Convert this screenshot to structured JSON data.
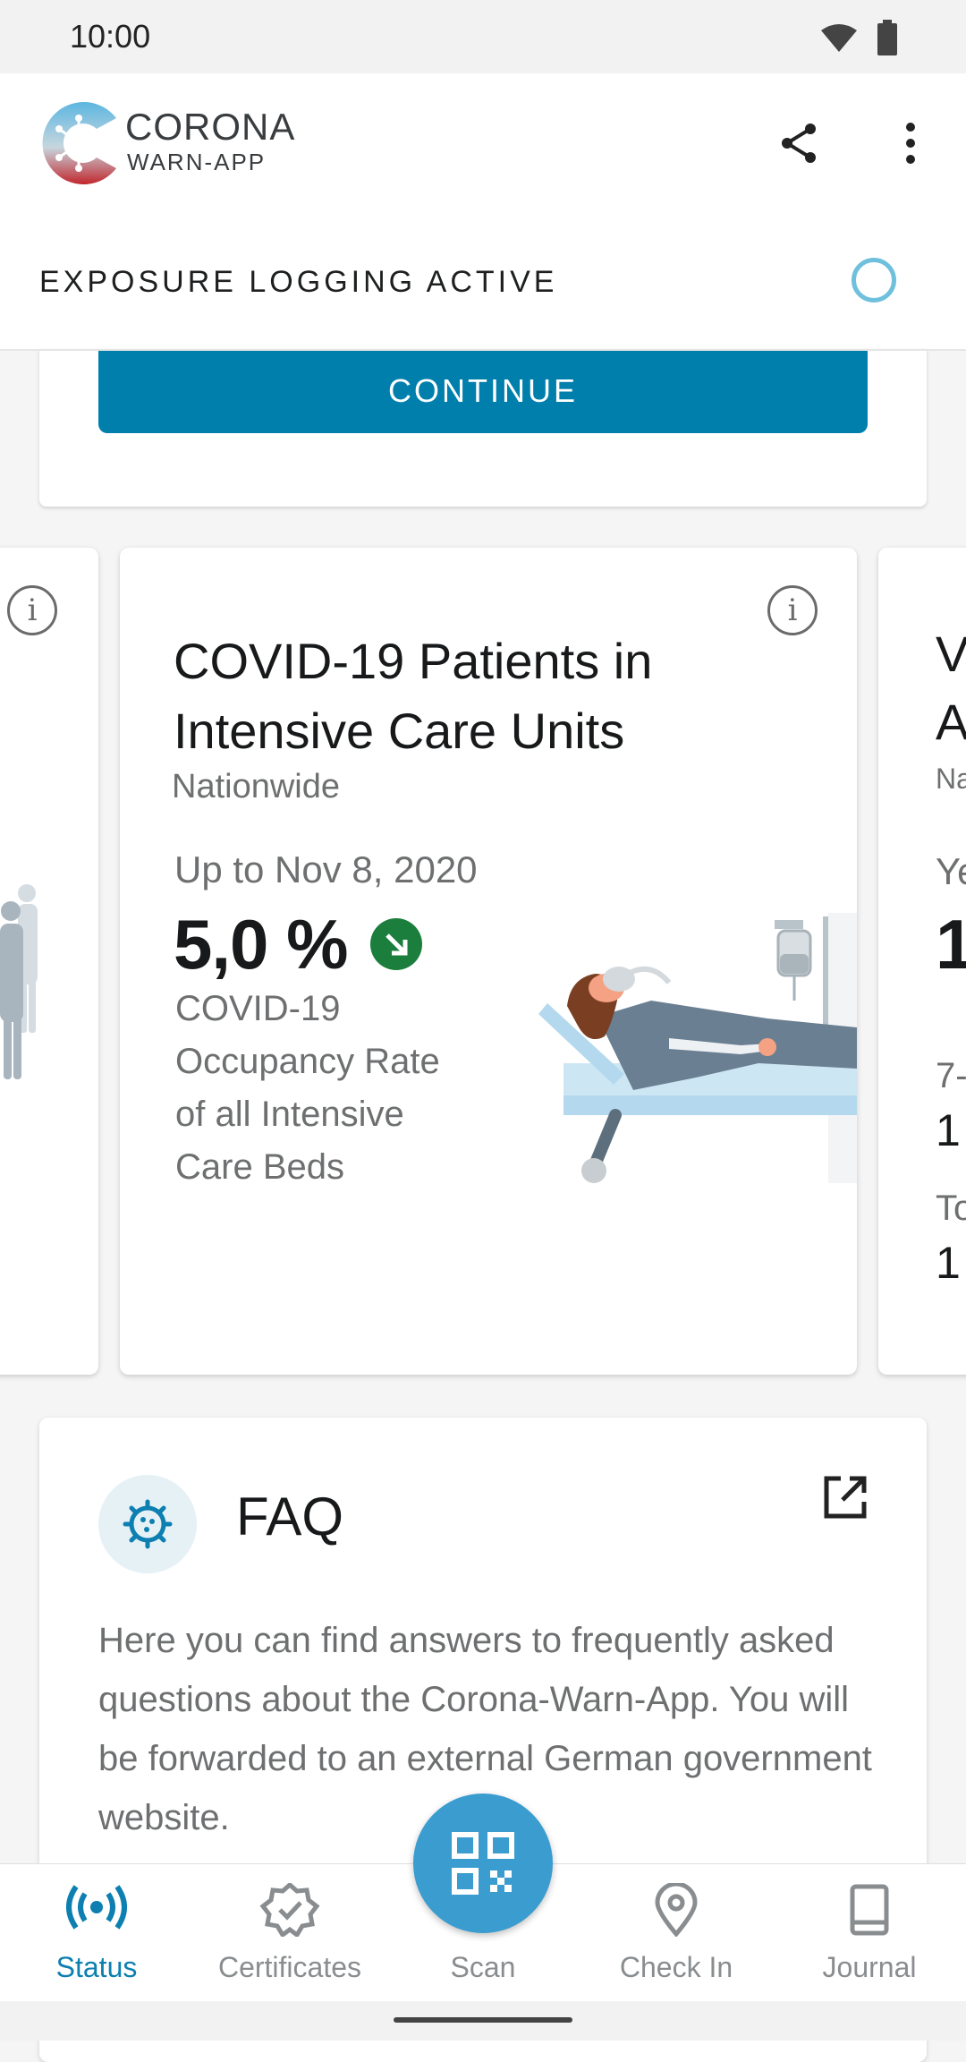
{
  "status_bar": {
    "time": "10:00"
  },
  "header": {
    "brand_line1": "CORONA",
    "brand_line2": "WARN-APP",
    "exposure_status": "EXPOSURE LOGGING ACTIVE"
  },
  "continue_card": {
    "button_label": "CONTINUE"
  },
  "stats": {
    "main_card": {
      "title": "COVID-19 Patients in Intensive Care Units",
      "region": "Nationwide",
      "date": "Up to Nov 8, 2020",
      "value": "5,0 %",
      "trend": "decreasing",
      "description": "COVID-19 Occupancy Rate of all Intensive Care Beds"
    },
    "right_card_partial": {
      "t1": "V",
      "t2": "A",
      "region": "Na",
      "l1": "Ye",
      "v1": "1",
      "l2": "7-",
      "v2": "1",
      "l3": "To",
      "v3": "1"
    }
  },
  "faq": {
    "title": "FAQ",
    "body": "Here you can find answers to frequently asked questions about the Corona-Warn-App. You will be forwarded to an external German government website."
  },
  "bottom_nav": {
    "items": [
      {
        "label": "Status",
        "icon": "radio-waves-icon",
        "active": true
      },
      {
        "label": "Certificates",
        "icon": "certificate-badge-icon",
        "active": false
      },
      {
        "label": "Scan",
        "icon": "qr-code-icon",
        "active": false
      },
      {
        "label": "Check In",
        "icon": "location-pin-icon",
        "active": false
      },
      {
        "label": "Journal",
        "icon": "book-icon",
        "active": false
      }
    ]
  },
  "colors": {
    "primary": "#007fad",
    "active_nav": "#0d7fb0",
    "inactive_nav": "#8a8d8f",
    "trend_green": "#1b7e3d",
    "scan_button": "#3a9ccf"
  }
}
